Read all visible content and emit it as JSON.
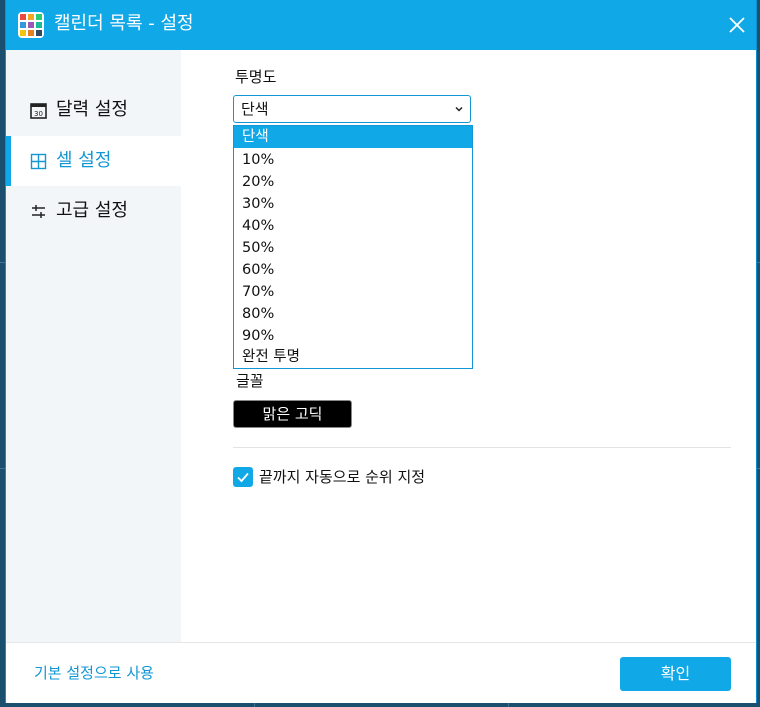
{
  "window": {
    "title": "캘린더 목록 - 설정",
    "accent_color": "#10a8e6",
    "app_icon": "calendar-grid-icon",
    "close_icon": "close-icon"
  },
  "sidebar": {
    "items": [
      {
        "label": "달력 설정",
        "icon": "calendar-icon",
        "active": false
      },
      {
        "label": "셀 설정",
        "icon": "grid-icon",
        "active": true
      },
      {
        "label": "고급 설정",
        "icon": "sliders-icon",
        "active": false
      }
    ]
  },
  "main": {
    "opacity_label": "투명도",
    "opacity_selected": "단색",
    "opacity_options": [
      "단색",
      "10%",
      "20%",
      "30%",
      "40%",
      "50%",
      "60%",
      "70%",
      "80%",
      "90%",
      "완전 투명"
    ],
    "font_label": "글꼴",
    "font_value": "맑은 고딕",
    "auto_rank_label": "끝까지 자동으로 순위 지정",
    "auto_rank_checked": true
  },
  "footer": {
    "default_link": "기본 설정으로 사용",
    "ok_button": "확인"
  }
}
